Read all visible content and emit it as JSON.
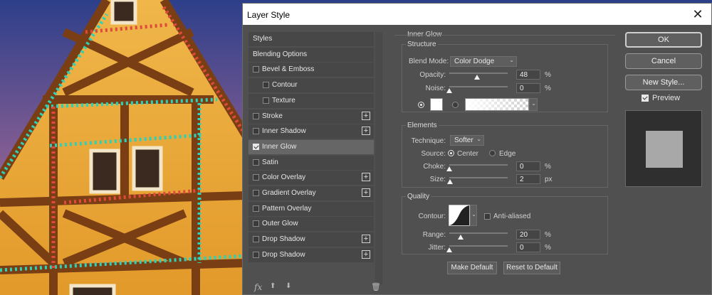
{
  "dialog": {
    "title": "Layer Style",
    "close_glyph": "✕"
  },
  "style_list": [
    {
      "label": "Styles",
      "checkbox": false,
      "checked": false,
      "plus": false,
      "indent": 0
    },
    {
      "label": "Blending Options",
      "checkbox": false,
      "checked": false,
      "plus": false,
      "indent": 0
    },
    {
      "label": "Bevel & Emboss",
      "checkbox": true,
      "checked": false,
      "plus": false,
      "indent": 0
    },
    {
      "label": "Contour",
      "checkbox": true,
      "checked": false,
      "plus": false,
      "indent": 1
    },
    {
      "label": "Texture",
      "checkbox": true,
      "checked": false,
      "plus": false,
      "indent": 1
    },
    {
      "label": "Stroke",
      "checkbox": true,
      "checked": false,
      "plus": true,
      "indent": 0
    },
    {
      "label": "Inner Shadow",
      "checkbox": true,
      "checked": false,
      "plus": true,
      "indent": 0
    },
    {
      "label": "Inner Glow",
      "checkbox": true,
      "checked": true,
      "plus": false,
      "indent": 0,
      "selected": true
    },
    {
      "label": "Satin",
      "checkbox": true,
      "checked": false,
      "plus": false,
      "indent": 0
    },
    {
      "label": "Color Overlay",
      "checkbox": true,
      "checked": false,
      "plus": true,
      "indent": 0
    },
    {
      "label": "Gradient Overlay",
      "checkbox": true,
      "checked": false,
      "plus": true,
      "indent": 0
    },
    {
      "label": "Pattern Overlay",
      "checkbox": true,
      "checked": false,
      "plus": false,
      "indent": 0
    },
    {
      "label": "Outer Glow",
      "checkbox": true,
      "checked": false,
      "plus": false,
      "indent": 0
    },
    {
      "label": "Drop Shadow",
      "checkbox": true,
      "checked": false,
      "plus": true,
      "indent": 0
    },
    {
      "label": "Drop Shadow",
      "checkbox": true,
      "checked": false,
      "plus": true,
      "indent": 0
    }
  ],
  "list_footer": {
    "fx_label": "fx",
    "up_glyph": "⬆",
    "down_glyph": "⬇",
    "trash_glyph": "🗑"
  },
  "inner_glow": {
    "section_title": "Inner Glow",
    "structure": {
      "title": "Structure",
      "blend_mode_label": "Blend Mode:",
      "blend_mode_value": "Color Dodge",
      "opacity_label": "Opacity:",
      "opacity_value": "48",
      "opacity_unit": "%",
      "opacity_fraction": 0.48,
      "noise_label": "Noise:",
      "noise_value": "0",
      "noise_unit": "%",
      "noise_fraction": 0.0,
      "color_swatch": "#ffffff"
    },
    "elements": {
      "title": "Elements",
      "technique_label": "Technique:",
      "technique_value": "Softer",
      "source_label": "Source:",
      "source_center": "Center",
      "source_edge": "Edge",
      "choke_label": "Choke:",
      "choke_value": "0",
      "choke_unit": "%",
      "choke_fraction": 0.0,
      "size_label": "Size:",
      "size_value": "2",
      "size_unit": "px",
      "size_fraction": 0.008
    },
    "quality": {
      "title": "Quality",
      "contour_label": "Contour:",
      "anti_aliased_label": "Anti-aliased",
      "range_label": "Range:",
      "range_value": "20",
      "range_unit": "%",
      "range_fraction": 0.2,
      "jitter_label": "Jitter:",
      "jitter_value": "0",
      "jitter_unit": "%",
      "jitter_fraction": 0.0
    },
    "make_default_label": "Make Default",
    "reset_default_label": "Reset to Default"
  },
  "actions": {
    "ok_label": "OK",
    "cancel_label": "Cancel",
    "new_style_label": "New Style...",
    "preview_label": "Preview",
    "preview_checked": true
  }
}
